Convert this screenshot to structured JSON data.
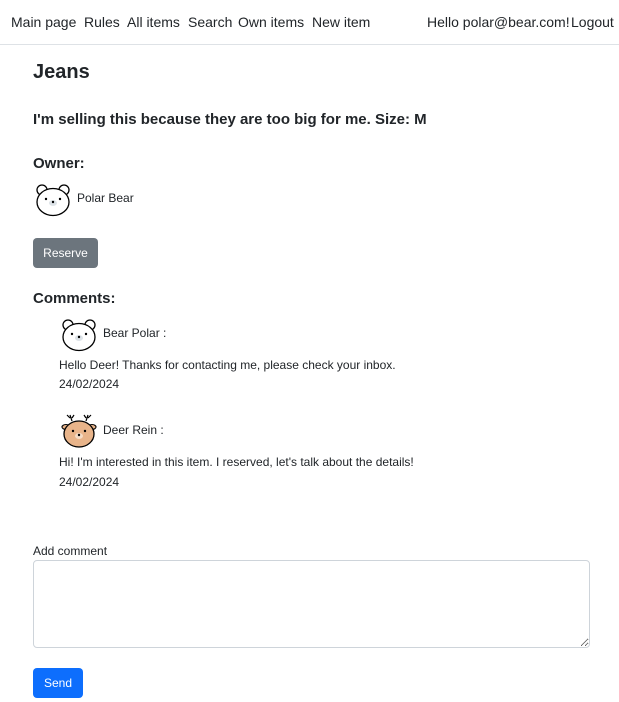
{
  "nav": {
    "links": [
      "Main page",
      "Rules",
      "All items",
      "Search",
      "Own items",
      "New item"
    ],
    "greeting": "Hello polar@bear.com!",
    "logout": "Logout"
  },
  "item": {
    "title": "Jeans",
    "description": "I'm selling this because they are too big for me. Size: M"
  },
  "owner": {
    "heading": "Owner:",
    "name": "Polar Bear",
    "avatar_icon": "polar-bear-icon"
  },
  "reserve_label": "Reserve",
  "comments": {
    "heading": "Comments:",
    "items": [
      {
        "author": "Bear Polar :",
        "avatar_icon": "polar-bear-icon",
        "text": "Hello Deer! Thanks for contacting me, please check your inbox.",
        "date": "24/02/2024"
      },
      {
        "author": "Deer Rein :",
        "avatar_icon": "deer-icon",
        "text": "Hi! I'm interested in this item. I reserved, let's talk about the details!",
        "date": "24/02/2024"
      }
    ]
  },
  "add_comment": {
    "label": "Add comment",
    "value": "",
    "send_label": "Send"
  },
  "colors": {
    "reserve_button": "#6c757d",
    "send_button": "#0d6efd",
    "deer_face": "#e8b48a"
  }
}
